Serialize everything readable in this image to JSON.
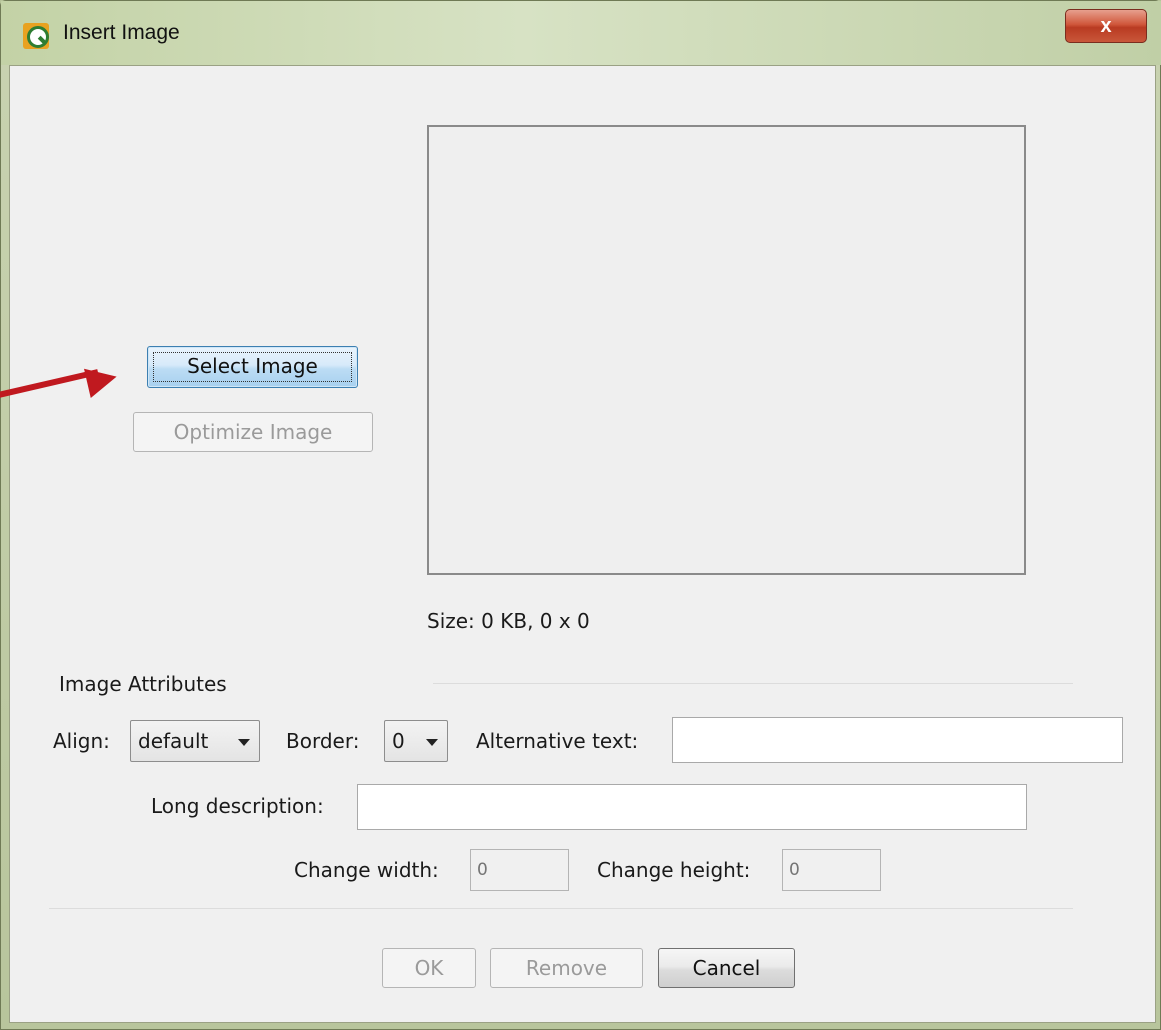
{
  "window": {
    "title": "Insert Image",
    "close_glyph": "x"
  },
  "preview": {
    "size_text": "Size: 0 KB,  0 x 0"
  },
  "buttons": {
    "select_image": "Select Image",
    "optimize_image": "Optimize Image",
    "ok": "OK",
    "remove": "Remove",
    "cancel": "Cancel"
  },
  "attributes": {
    "section_label": "Image Attributes",
    "align_label": "Align:",
    "align_value": "default",
    "border_label": "Border:",
    "border_value": "0",
    "alt_text_label": "Alternative text:",
    "alt_text_value": "",
    "long_desc_label": "Long description:",
    "long_desc_value": "",
    "change_width_label": "Change width:",
    "change_width_placeholder": "0",
    "change_height_label": "Change height:",
    "change_height_placeholder": "0"
  },
  "annotation": {
    "arrow_color": "#c0191f"
  }
}
